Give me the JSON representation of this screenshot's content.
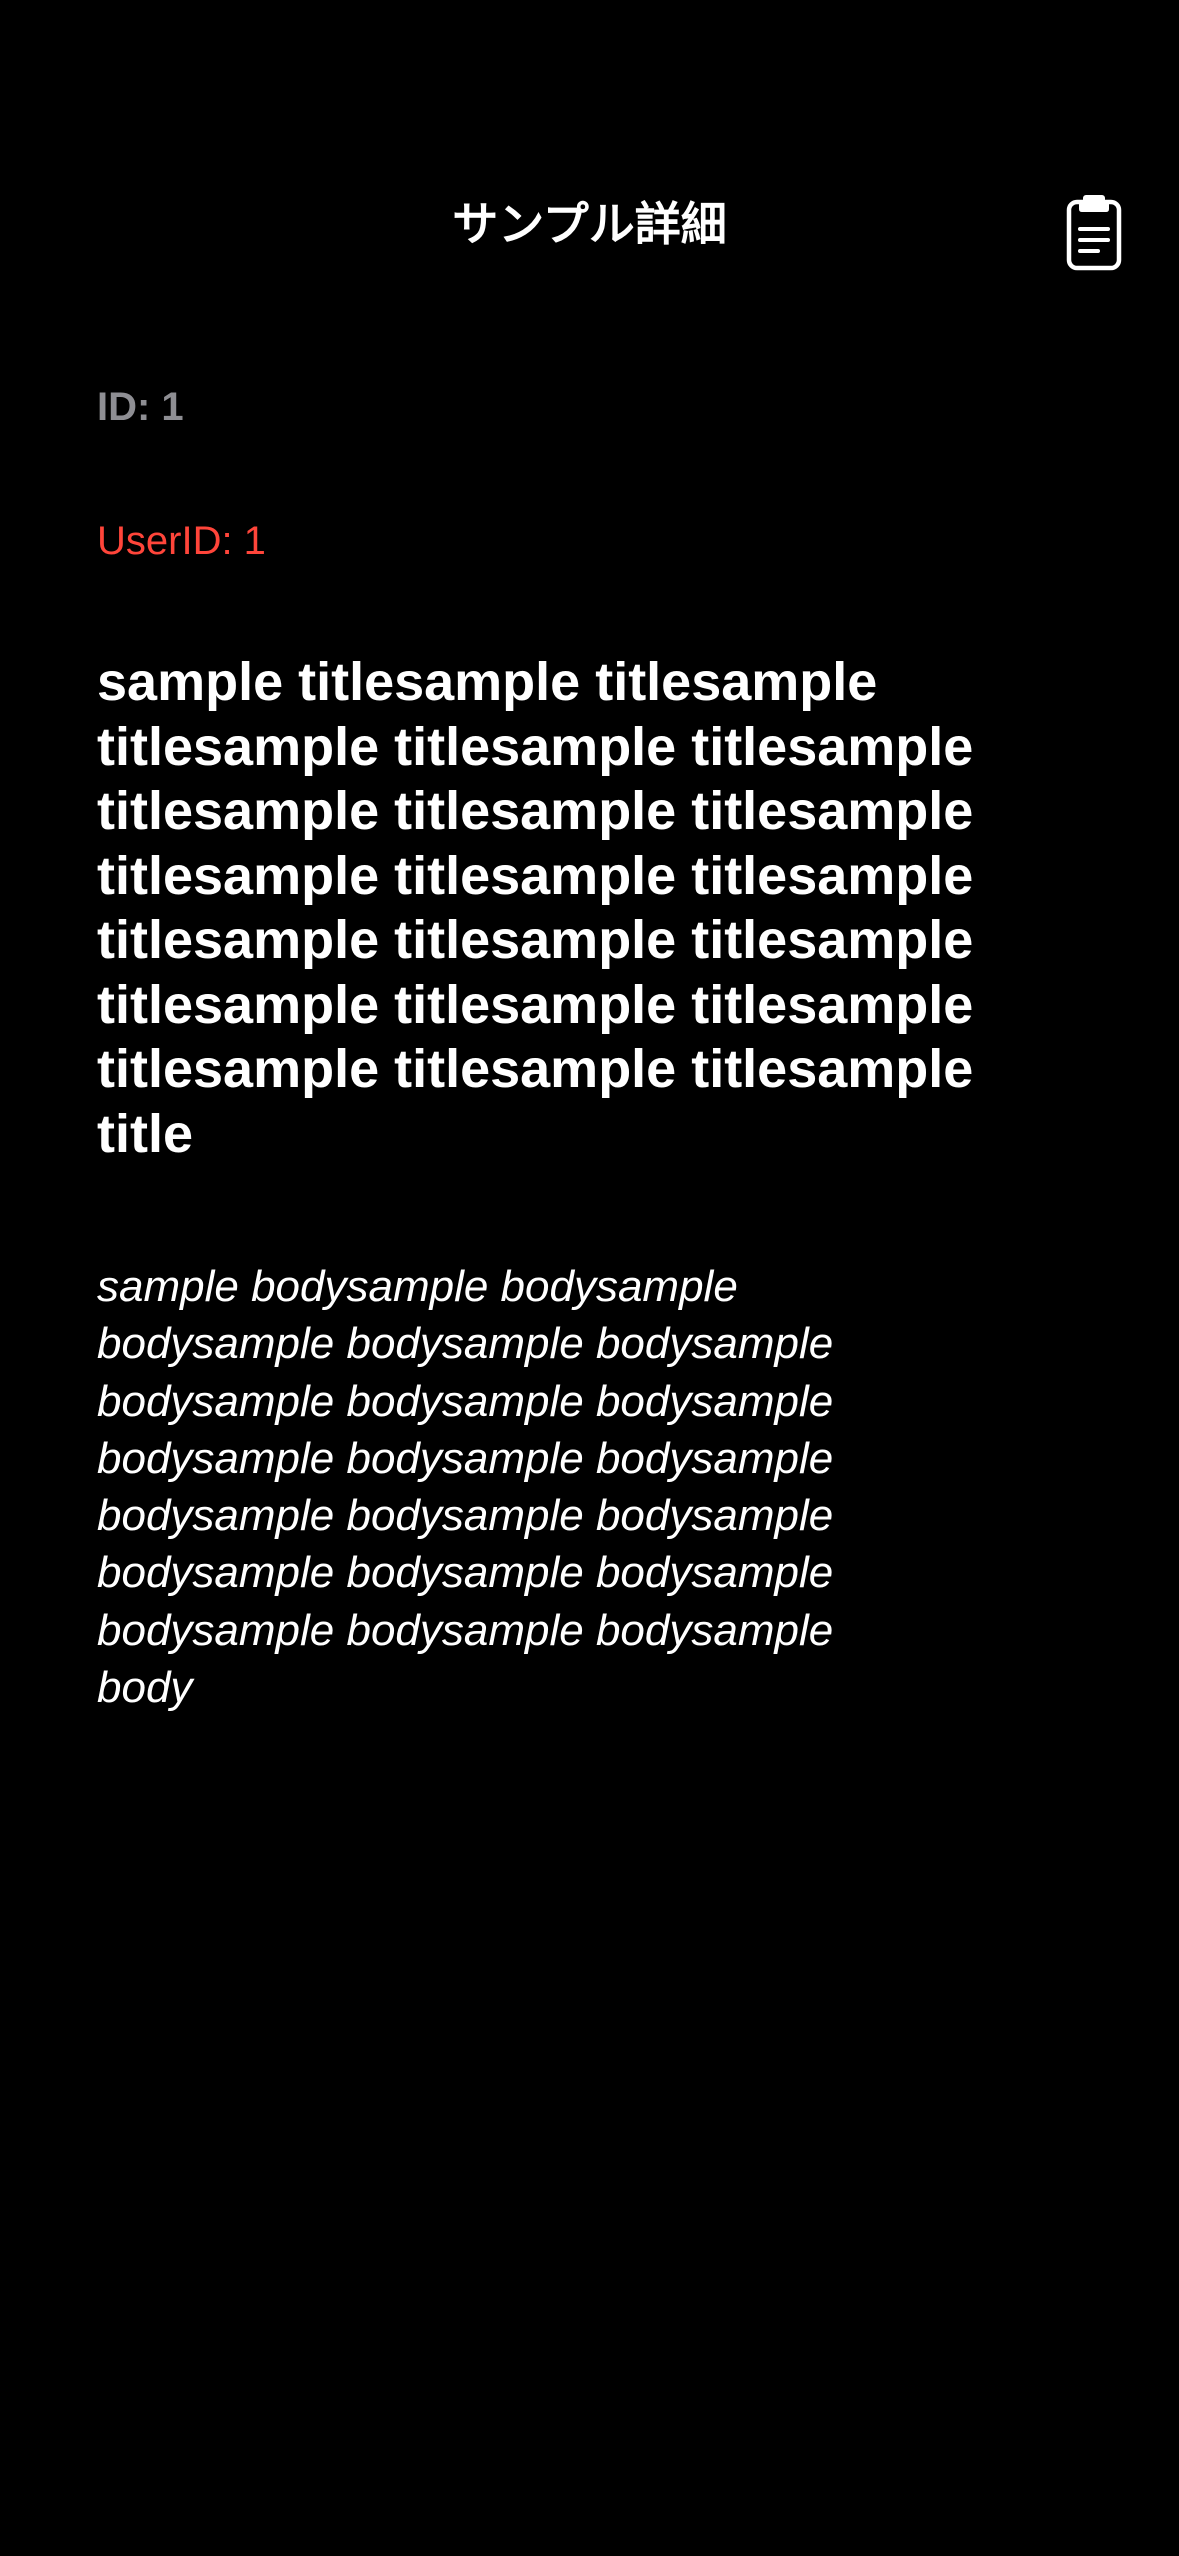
{
  "nav": {
    "title": "サンプル詳細",
    "clipboard_icon": "clipboard-icon"
  },
  "post": {
    "id_text": "ID: 1",
    "user_id_text": "UserID: 1",
    "title": "sample titlesample titlesample titlesample titlesample titlesample titlesample titlesample titlesample titlesample titlesample titlesample titlesample titlesample titlesample titlesample titlesample titlesample titlesample titlesample titlesample title",
    "body": "sample bodysample bodysample bodysample bodysample bodysample bodysample bodysample bodysample bodysample bodysample bodysample bodysample bodysample bodysample bodysample bodysample bodysample bodysample bodysample bodysample body"
  },
  "colors": {
    "background": "#000000",
    "text": "#ffffff",
    "id_gray": "#8e8e93",
    "user_id_red": "#ff453a"
  }
}
